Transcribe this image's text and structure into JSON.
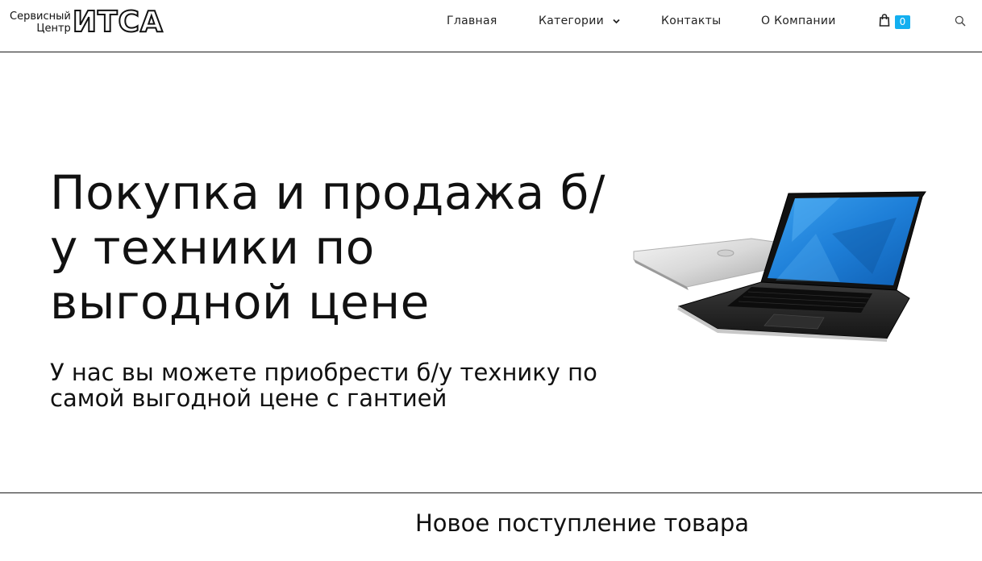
{
  "logo": {
    "line1": "Сервисный",
    "line2": "Центр",
    "brand": "ИТСА"
  },
  "nav": {
    "items": [
      {
        "label": "Главная"
      },
      {
        "label": "Категории",
        "has_dropdown": true
      },
      {
        "label": "Контакты"
      },
      {
        "label": "О Компании"
      }
    ],
    "cart_count": "0",
    "icons": {
      "cart": "shopping-bag-icon",
      "search": "search-icon",
      "dropdown": "chevron-down-icon"
    }
  },
  "hero": {
    "title": "Покупка и продажа б/у техники по выгодной цене",
    "subtitle": "У нас вы можете приобрести б/у технику по самой выгодной цене с гантией",
    "image": "laptop-image"
  },
  "section": {
    "title": "Новое поступление товара"
  },
  "colors": {
    "accent": "#13aff0",
    "text": "#111111",
    "divider": "#1a1a1a",
    "screen_blue": "#1e7fd8"
  }
}
